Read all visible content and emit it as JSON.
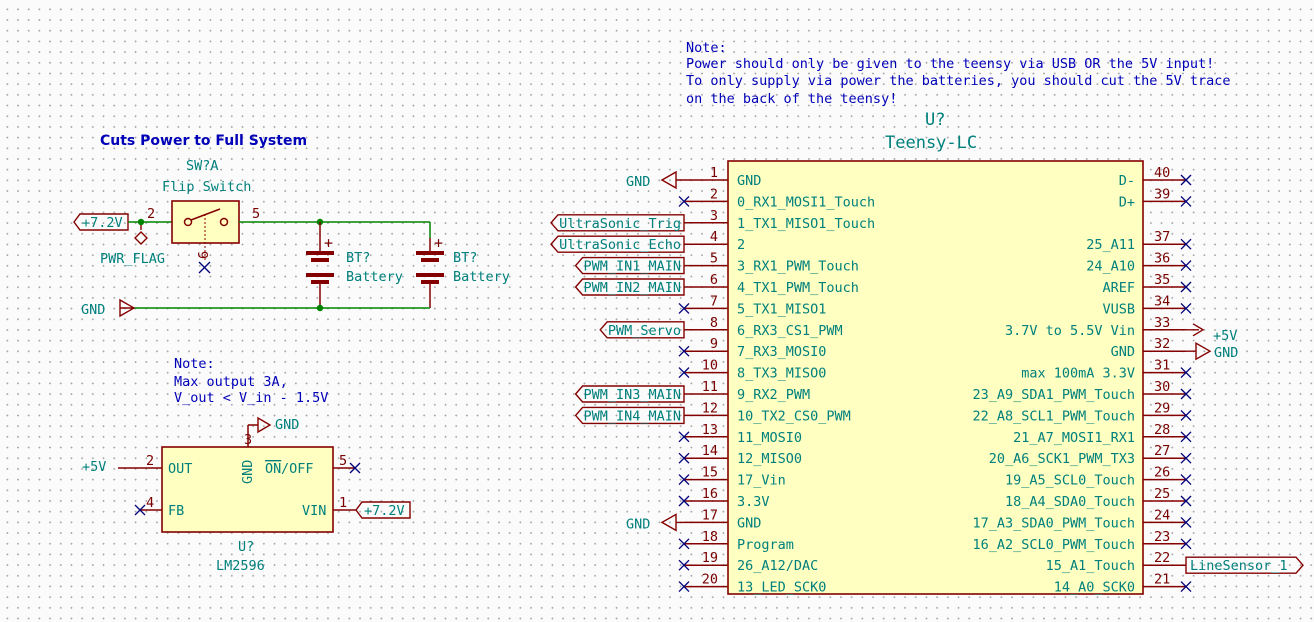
{
  "title_note": {
    "label": "Note:",
    "lines": [
      "Power should only be given to the teensy via USB OR the 5V input!",
      "To only supply via power the batteries, you should cut the 5V trace",
      "on the back of the teensy!"
    ]
  },
  "power_section": {
    "heading": "Cuts Power to Full System",
    "switch_ref": "SW?A",
    "switch_value": "Flip Switch",
    "switch_pin_left": "2",
    "switch_pin_right": "5",
    "switch_pin_bottom": "6",
    "supply_label": "+7.2V",
    "pwr_flag": "PWR_FLAG",
    "gnd_label": "GND",
    "battery_ref": "BT?",
    "battery_value": "Battery"
  },
  "regulator_note": {
    "label": "Note:",
    "lines": [
      "Max output 3A,",
      "V_out < V_in - 1.5V"
    ]
  },
  "regulator": {
    "ref": "U?",
    "value": "LM2596",
    "gnd_label": "GND",
    "out_net": "+5V",
    "in_net": "+7.2V",
    "pins": {
      "out": {
        "num": "2",
        "name": "OUT"
      },
      "fb": {
        "num": "4",
        "name": "FB"
      },
      "gnd": {
        "num": "3",
        "name": "GND"
      },
      "onoff": {
        "num": "5",
        "name": "ON",
        "suffix": "/OFF"
      },
      "vin": {
        "num": "1",
        "name": "VIN"
      }
    }
  },
  "teensy": {
    "ref": "U?",
    "value": "Teensy-LC",
    "left_pins": [
      {
        "num": "1",
        "name": "GND",
        "net": "GND"
      },
      {
        "num": "2",
        "name": "0_RX1_MOSI1_Touch",
        "net": ""
      },
      {
        "num": "3",
        "name": "1_TX1_MISO1_Touch",
        "net": "UltraSonic_Trig"
      },
      {
        "num": "4",
        "name": "2",
        "net": "UltraSonic_Echo"
      },
      {
        "num": "5",
        "name": "3_RX1_PWM_Touch",
        "net": "PWM_IN1_MAIN"
      },
      {
        "num": "6",
        "name": "4_TX1_PWM_Touch",
        "net": "PWM_IN2_MAIN"
      },
      {
        "num": "7",
        "name": "5_TX1_MISO1",
        "net": ""
      },
      {
        "num": "8",
        "name": "6_RX3_CS1_PWM",
        "net": "PWM_Servo"
      },
      {
        "num": "9",
        "name": "7_RX3_MOSI0",
        "net": ""
      },
      {
        "num": "10",
        "name": "8_TX3_MISO0",
        "net": ""
      },
      {
        "num": "11",
        "name": "9_RX2_PWM",
        "net": "PWM_IN3_MAIN"
      },
      {
        "num": "12",
        "name": "10_TX2_CS0_PWM",
        "net": "PWM_IN4_MAIN"
      },
      {
        "num": "13",
        "name": "11_MOSI0",
        "net": ""
      },
      {
        "num": "14",
        "name": "12_MISO0",
        "net": ""
      },
      {
        "num": "15",
        "name": "17_Vin",
        "net": ""
      },
      {
        "num": "16",
        "name": "3.3V",
        "net": ""
      },
      {
        "num": "17",
        "name": "GND",
        "net": "GND"
      },
      {
        "num": "18",
        "name": "Program",
        "net": ""
      },
      {
        "num": "19",
        "name": "26_A12/DAC",
        "net": ""
      },
      {
        "num": "20",
        "name": "13_LED_SCK0",
        "net": ""
      }
    ],
    "right_pins": [
      {
        "num": "40",
        "name": "D-",
        "net": ""
      },
      {
        "num": "39",
        "name": "D+",
        "net": ""
      },
      {
        "num": "",
        "name": "",
        "net": ""
      },
      {
        "num": "37",
        "name": "25_A11",
        "net": ""
      },
      {
        "num": "36",
        "name": "24_A10",
        "net": ""
      },
      {
        "num": "35",
        "name": "AREF",
        "net": ""
      },
      {
        "num": "34",
        "name": "VUSB",
        "net": ""
      },
      {
        "num": "33",
        "name": "3.7V to 5.5V Vin",
        "net": "+5V"
      },
      {
        "num": "32",
        "name": "GND",
        "net": "GND"
      },
      {
        "num": "31",
        "name": "max 100mA  3.3V",
        "net": ""
      },
      {
        "num": "30",
        "name": "23_A9_SDA1_PWM_Touch",
        "net": ""
      },
      {
        "num": "29",
        "name": "22_A8_SCL1_PWM_Touch",
        "net": ""
      },
      {
        "num": "28",
        "name": "21_A7_MOSI1_RX1",
        "net": ""
      },
      {
        "num": "27",
        "name": "20_A6_SCK1_PWM_TX3",
        "net": ""
      },
      {
        "num": "26",
        "name": "19_A5_SCL0_Touch",
        "net": ""
      },
      {
        "num": "25",
        "name": "18_A4_SDA0_Touch",
        "net": ""
      },
      {
        "num": "24",
        "name": "17_A3_SDA0_PWM_Touch",
        "net": ""
      },
      {
        "num": "23",
        "name": "16_A2_SCL0_PWM_Touch",
        "net": ""
      },
      {
        "num": "22",
        "name": "15_A1_Touch",
        "net": "LineSensor_1"
      },
      {
        "num": "21",
        "name": "14_A0_SCK0",
        "net": ""
      }
    ]
  }
}
